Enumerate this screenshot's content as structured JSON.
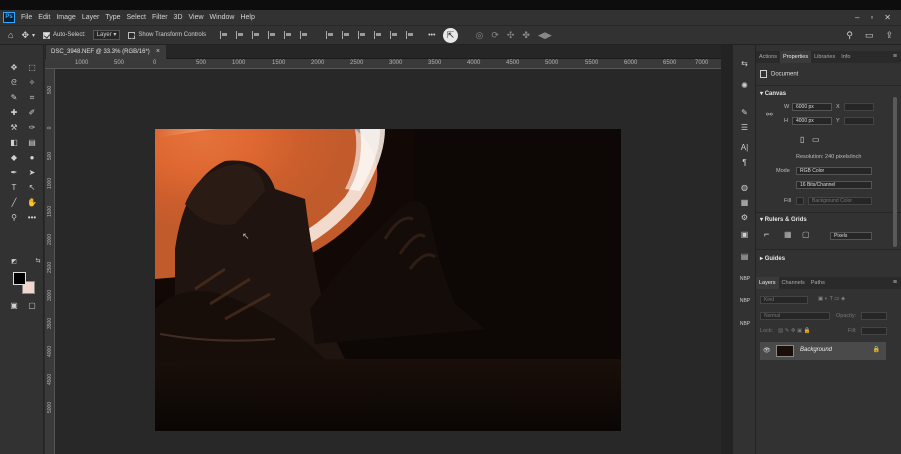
{
  "app": {
    "logo_text": "Ps",
    "menu": [
      "File",
      "Edit",
      "Image",
      "Layer",
      "Type",
      "Select",
      "Filter",
      "3D",
      "View",
      "Window",
      "Help"
    ],
    "window_controls": [
      "–",
      "▫",
      "✕"
    ]
  },
  "options_bar": {
    "auto_select_label": "Auto-Select:",
    "auto_select_value": "Layer",
    "transform_controls_label": "Show Transform Controls",
    "more_label": "•••"
  },
  "document": {
    "tab_title": "DSC_3948.NEF @ 33.3% (RGB/16*)",
    "close": "×"
  },
  "ruler": {
    "h_ticks": [
      "1000",
      "500",
      "0",
      "500",
      "1000",
      "1500",
      "2000",
      "2500",
      "3000",
      "3500",
      "4000",
      "4500",
      "5000",
      "5500",
      "6000",
      "6500",
      "7000"
    ],
    "v_ticks": [
      "500",
      "0",
      "500",
      "1000",
      "1500",
      "2000",
      "2500",
      "3000",
      "3500",
      "4000",
      "4500",
      "5000"
    ]
  },
  "properties_panel": {
    "tabs": [
      "Actions",
      "Properties",
      "Libraries",
      "Info"
    ],
    "active_tab": "Properties",
    "menu": "≡",
    "document_label": "Document",
    "canvas_section": "Canvas",
    "w_label": "W",
    "w_value": "6000 px",
    "h_label": "H",
    "h_value": "4000 px",
    "x_label": "X",
    "y_label": "Y",
    "resolution": "Resolution: 240 pixels/inch",
    "mode_label": "Mode",
    "mode_value": "RGB Color",
    "depth_value": "16 Bits/Channel",
    "fill_label": "Fill",
    "fill_value": "Background Color",
    "rulers_section": "Rulers & Grids",
    "rulers_unit": "Pixels",
    "guides_section": "Guides"
  },
  "layers_panel": {
    "tabs": [
      "Layers",
      "Channels",
      "Paths"
    ],
    "active_tab": "Layers",
    "kind_placeholder": "Kind",
    "blend_mode": "Normal",
    "opacity_label": "Opacity:",
    "lock_label": "Lock:",
    "fill_label": "Fill:",
    "layer_name": "Background"
  },
  "right_icon_col": {
    "nbp_labels": [
      "NBP",
      "NBP",
      "NBP"
    ]
  },
  "colors": {
    "ui_dark": "#323232",
    "canvas_bg": "#282828",
    "accent": "#31a8ff",
    "foreground_swatch": "#000000",
    "background_swatch": "#f3d6d0"
  }
}
